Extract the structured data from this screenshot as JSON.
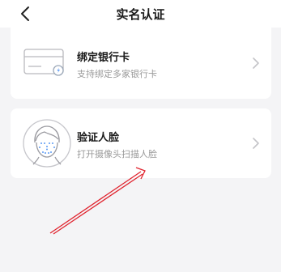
{
  "header": {
    "title": "实名认证",
    "back_icon": "chevron-left-icon"
  },
  "options": [
    {
      "title": "绑定银行卡",
      "subtitle": "支持绑定多家银行卡",
      "icon": "bank-card-icon",
      "chevron_icon": "chevron-right-icon"
    },
    {
      "title": "验证人脸",
      "subtitle": "打开摄像头扫描人脸",
      "icon": "face-scan-icon",
      "chevron_icon": "chevron-right-icon"
    }
  ],
  "annotation": {
    "icon": "red-arrow-icon",
    "color": "#e0232e"
  }
}
